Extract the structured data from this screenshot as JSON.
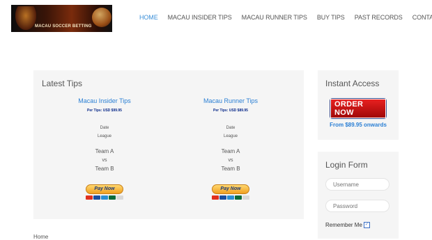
{
  "header": {
    "logo_text": "MACAU SOCCER BETTING",
    "nav": [
      {
        "label": "HOME"
      },
      {
        "label": "MACAU INSIDER TIPS"
      },
      {
        "label": "MACAU RUNNER TIPS"
      },
      {
        "label": "BUY TIPS"
      },
      {
        "label": "PAST RECORDS"
      },
      {
        "label": "CONTACT US"
      }
    ],
    "active_color": "#3a8fd8"
  },
  "latest_tips": {
    "title": "Latest Tips",
    "columns": [
      {
        "title": "Macau Insider Tips",
        "price": "Per Tips: USD $99.95",
        "date": "Date",
        "league": "League",
        "team_a": "Team A",
        "vs": "vs",
        "team_b": "Team B",
        "pay_label": "Pay Now"
      },
      {
        "title": "Macau Runner Tips",
        "price": "Per Tips: USD $89.95",
        "date": "Date",
        "league": "League",
        "team_a": "Team A",
        "vs": "vs",
        "team_b": "Team B",
        "pay_label": "Pay Now"
      }
    ]
  },
  "instant_access": {
    "title": "Instant Access",
    "order_label": "ORDER NOW",
    "from_text": "From $89.95 onwards"
  },
  "login": {
    "title": "Login Form",
    "username_placeholder": "Username",
    "password_placeholder": "Password",
    "remember_label": "Remember Me"
  },
  "breadcrumb": {
    "home": "Home"
  }
}
